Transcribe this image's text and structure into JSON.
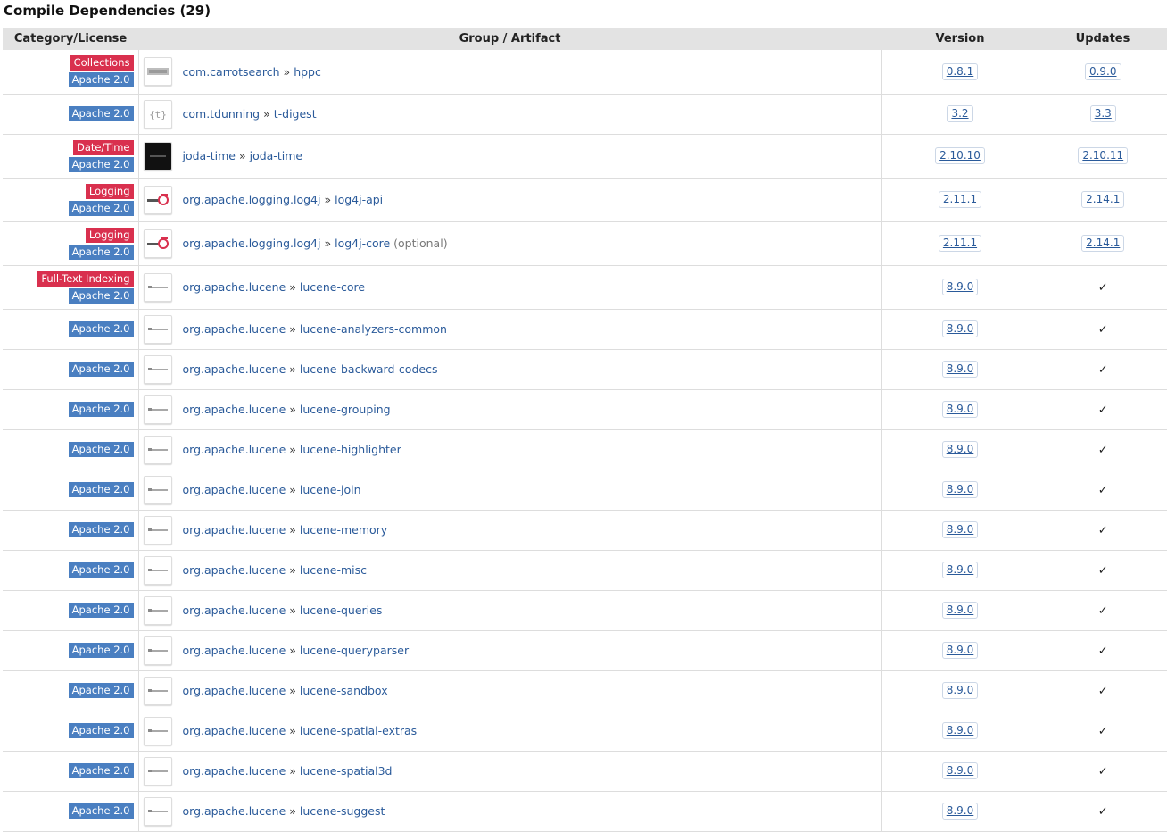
{
  "section": {
    "title": "Compile Dependencies (29)"
  },
  "table": {
    "headers": {
      "category": "Category/License",
      "artifact": "Group / Artifact",
      "version": "Version",
      "updates": "Updates"
    },
    "colors": {
      "category_badge": "#d9304e",
      "license_badge": "#4a7fc1",
      "header_bg": "#e3e3e3",
      "link": "#2a5a9a"
    },
    "rows": [
      {
        "category": "Collections",
        "license": "Apache 2.0",
        "logo": "carrotsearch-logo",
        "group": "com.carrotsearch",
        "sep": "»",
        "artifact": "hppc",
        "note": "",
        "version": "0.8.1",
        "update": "0.9.0",
        "check": ""
      },
      {
        "category": "",
        "license": "Apache 2.0",
        "logo": "tdunning-logo",
        "group": "com.tdunning",
        "sep": "»",
        "artifact": "t-digest",
        "note": "",
        "version": "3.2",
        "update": "3.3",
        "check": ""
      },
      {
        "category": "Date/Time",
        "license": "Apache 2.0",
        "logo": "joda-time-logo",
        "group": "joda-time",
        "sep": "»",
        "artifact": "joda-time",
        "note": "",
        "version": "2.10.10",
        "update": "2.10.11",
        "check": ""
      },
      {
        "category": "Logging",
        "license": "Apache 2.0",
        "logo": "log4j-logo",
        "group": "org.apache.logging.log4j",
        "sep": "»",
        "artifact": "log4j-api",
        "note": "",
        "version": "2.11.1",
        "update": "2.14.1",
        "check": ""
      },
      {
        "category": "Logging",
        "license": "Apache 2.0",
        "logo": "log4j-logo",
        "group": "org.apache.logging.log4j",
        "sep": "»",
        "artifact": "log4j-core",
        "note": "(optional)",
        "version": "2.11.1",
        "update": "2.14.1",
        "check": ""
      },
      {
        "category": "Full-Text Indexing",
        "license": "Apache 2.0",
        "logo": "lucene-logo",
        "group": "org.apache.lucene",
        "sep": "»",
        "artifact": "lucene-core",
        "note": "",
        "version": "8.9.0",
        "update": "",
        "check": "✓"
      },
      {
        "category": "",
        "license": "Apache 2.0",
        "logo": "lucene-logo",
        "group": "org.apache.lucene",
        "sep": "»",
        "artifact": "lucene-analyzers-common",
        "note": "",
        "version": "8.9.0",
        "update": "",
        "check": "✓"
      },
      {
        "category": "",
        "license": "Apache 2.0",
        "logo": "lucene-logo",
        "group": "org.apache.lucene",
        "sep": "»",
        "artifact": "lucene-backward-codecs",
        "note": "",
        "version": "8.9.0",
        "update": "",
        "check": "✓"
      },
      {
        "category": "",
        "license": "Apache 2.0",
        "logo": "lucene-logo",
        "group": "org.apache.lucene",
        "sep": "»",
        "artifact": "lucene-grouping",
        "note": "",
        "version": "8.9.0",
        "update": "",
        "check": "✓"
      },
      {
        "category": "",
        "license": "Apache 2.0",
        "logo": "lucene-logo",
        "group": "org.apache.lucene",
        "sep": "»",
        "artifact": "lucene-highlighter",
        "note": "",
        "version": "8.9.0",
        "update": "",
        "check": "✓"
      },
      {
        "category": "",
        "license": "Apache 2.0",
        "logo": "lucene-logo",
        "group": "org.apache.lucene",
        "sep": "»",
        "artifact": "lucene-join",
        "note": "",
        "version": "8.9.0",
        "update": "",
        "check": "✓"
      },
      {
        "category": "",
        "license": "Apache 2.0",
        "logo": "lucene-logo",
        "group": "org.apache.lucene",
        "sep": "»",
        "artifact": "lucene-memory",
        "note": "",
        "version": "8.9.0",
        "update": "",
        "check": "✓"
      },
      {
        "category": "",
        "license": "Apache 2.0",
        "logo": "lucene-logo",
        "group": "org.apache.lucene",
        "sep": "»",
        "artifact": "lucene-misc",
        "note": "",
        "version": "8.9.0",
        "update": "",
        "check": "✓"
      },
      {
        "category": "",
        "license": "Apache 2.0",
        "logo": "lucene-logo",
        "group": "org.apache.lucene",
        "sep": "»",
        "artifact": "lucene-queries",
        "note": "",
        "version": "8.9.0",
        "update": "",
        "check": "✓"
      },
      {
        "category": "",
        "license": "Apache 2.0",
        "logo": "lucene-logo",
        "group": "org.apache.lucene",
        "sep": "»",
        "artifact": "lucene-queryparser",
        "note": "",
        "version": "8.9.0",
        "update": "",
        "check": "✓"
      },
      {
        "category": "",
        "license": "Apache 2.0",
        "logo": "lucene-logo",
        "group": "org.apache.lucene",
        "sep": "»",
        "artifact": "lucene-sandbox",
        "note": "",
        "version": "8.9.0",
        "update": "",
        "check": "✓"
      },
      {
        "category": "",
        "license": "Apache 2.0",
        "logo": "lucene-logo",
        "group": "org.apache.lucene",
        "sep": "»",
        "artifact": "lucene-spatial-extras",
        "note": "",
        "version": "8.9.0",
        "update": "",
        "check": "✓"
      },
      {
        "category": "",
        "license": "Apache 2.0",
        "logo": "lucene-logo",
        "group": "org.apache.lucene",
        "sep": "»",
        "artifact": "lucene-spatial3d",
        "note": "",
        "version": "8.9.0",
        "update": "",
        "check": "✓"
      },
      {
        "category": "",
        "license": "Apache 2.0",
        "logo": "lucene-logo",
        "group": "org.apache.lucene",
        "sep": "»",
        "artifact": "lucene-suggest",
        "note": "",
        "version": "8.9.0",
        "update": "",
        "check": "✓"
      }
    ]
  }
}
